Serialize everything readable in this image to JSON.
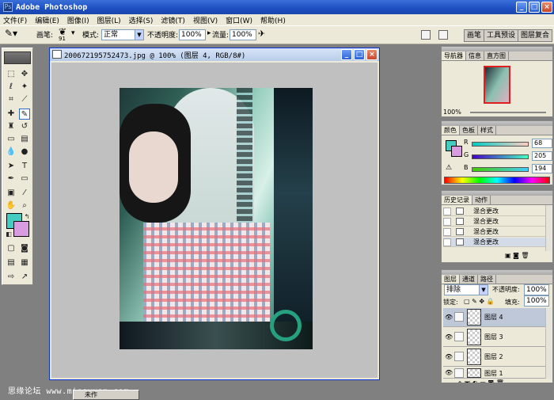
{
  "window": {
    "title": "Adobe Photoshop"
  },
  "menu": [
    "文件(F)",
    "编辑(E)",
    "图像(I)",
    "图层(L)",
    "选择(S)",
    "滤镜(T)",
    "视图(V)",
    "窗口(W)",
    "帮助(H)"
  ],
  "options": {
    "brush_label": "画笔:",
    "brush_size": "91",
    "mode_label": "模式:",
    "mode_value": "正常",
    "opacity_label": "不透明度:",
    "opacity_value": "100%",
    "flow_label": "流量:",
    "flow_value": "100%",
    "tabs": [
      "画笔",
      "工具预设",
      "图层复合"
    ]
  },
  "document": {
    "title": "200672195752473.jpg @ 100% (图层 4, RGB/8#)"
  },
  "navigator": {
    "tabs": [
      "导航器",
      "信息",
      "直方图"
    ],
    "zoom": "100%"
  },
  "color": {
    "tabs": [
      "颜色",
      "色板",
      "样式"
    ],
    "rows": [
      {
        "label": "R",
        "value": "68",
        "grad": "linear-gradient(90deg,#00ccc2,#ffccc2)"
      },
      {
        "label": "G",
        "value": "205",
        "grad": "linear-gradient(90deg,#4400c2,#44ffc2)"
      },
      {
        "label": "B",
        "value": "194",
        "grad": "linear-gradient(90deg,#44cc00,#44ccff)"
      }
    ]
  },
  "history": {
    "tabs": [
      "历史记录",
      "动作"
    ],
    "items": [
      "混合更改",
      "混合更改",
      "混合更改",
      "混合更改"
    ]
  },
  "layers": {
    "tabs": [
      "图层",
      "通道",
      "路径"
    ],
    "blend_mode": "排除",
    "opacity_label": "不透明度:",
    "opacity_value": "100%",
    "lock_label": "锁定:",
    "fill_label": "填充:",
    "fill_value": "100%",
    "items": [
      "图层 4",
      "图层 3",
      "图层 2",
      "图层 1"
    ]
  },
  "status": {
    "watermark": "思缘论坛 www.missyuan.com",
    "taskbar_label": "未作"
  }
}
